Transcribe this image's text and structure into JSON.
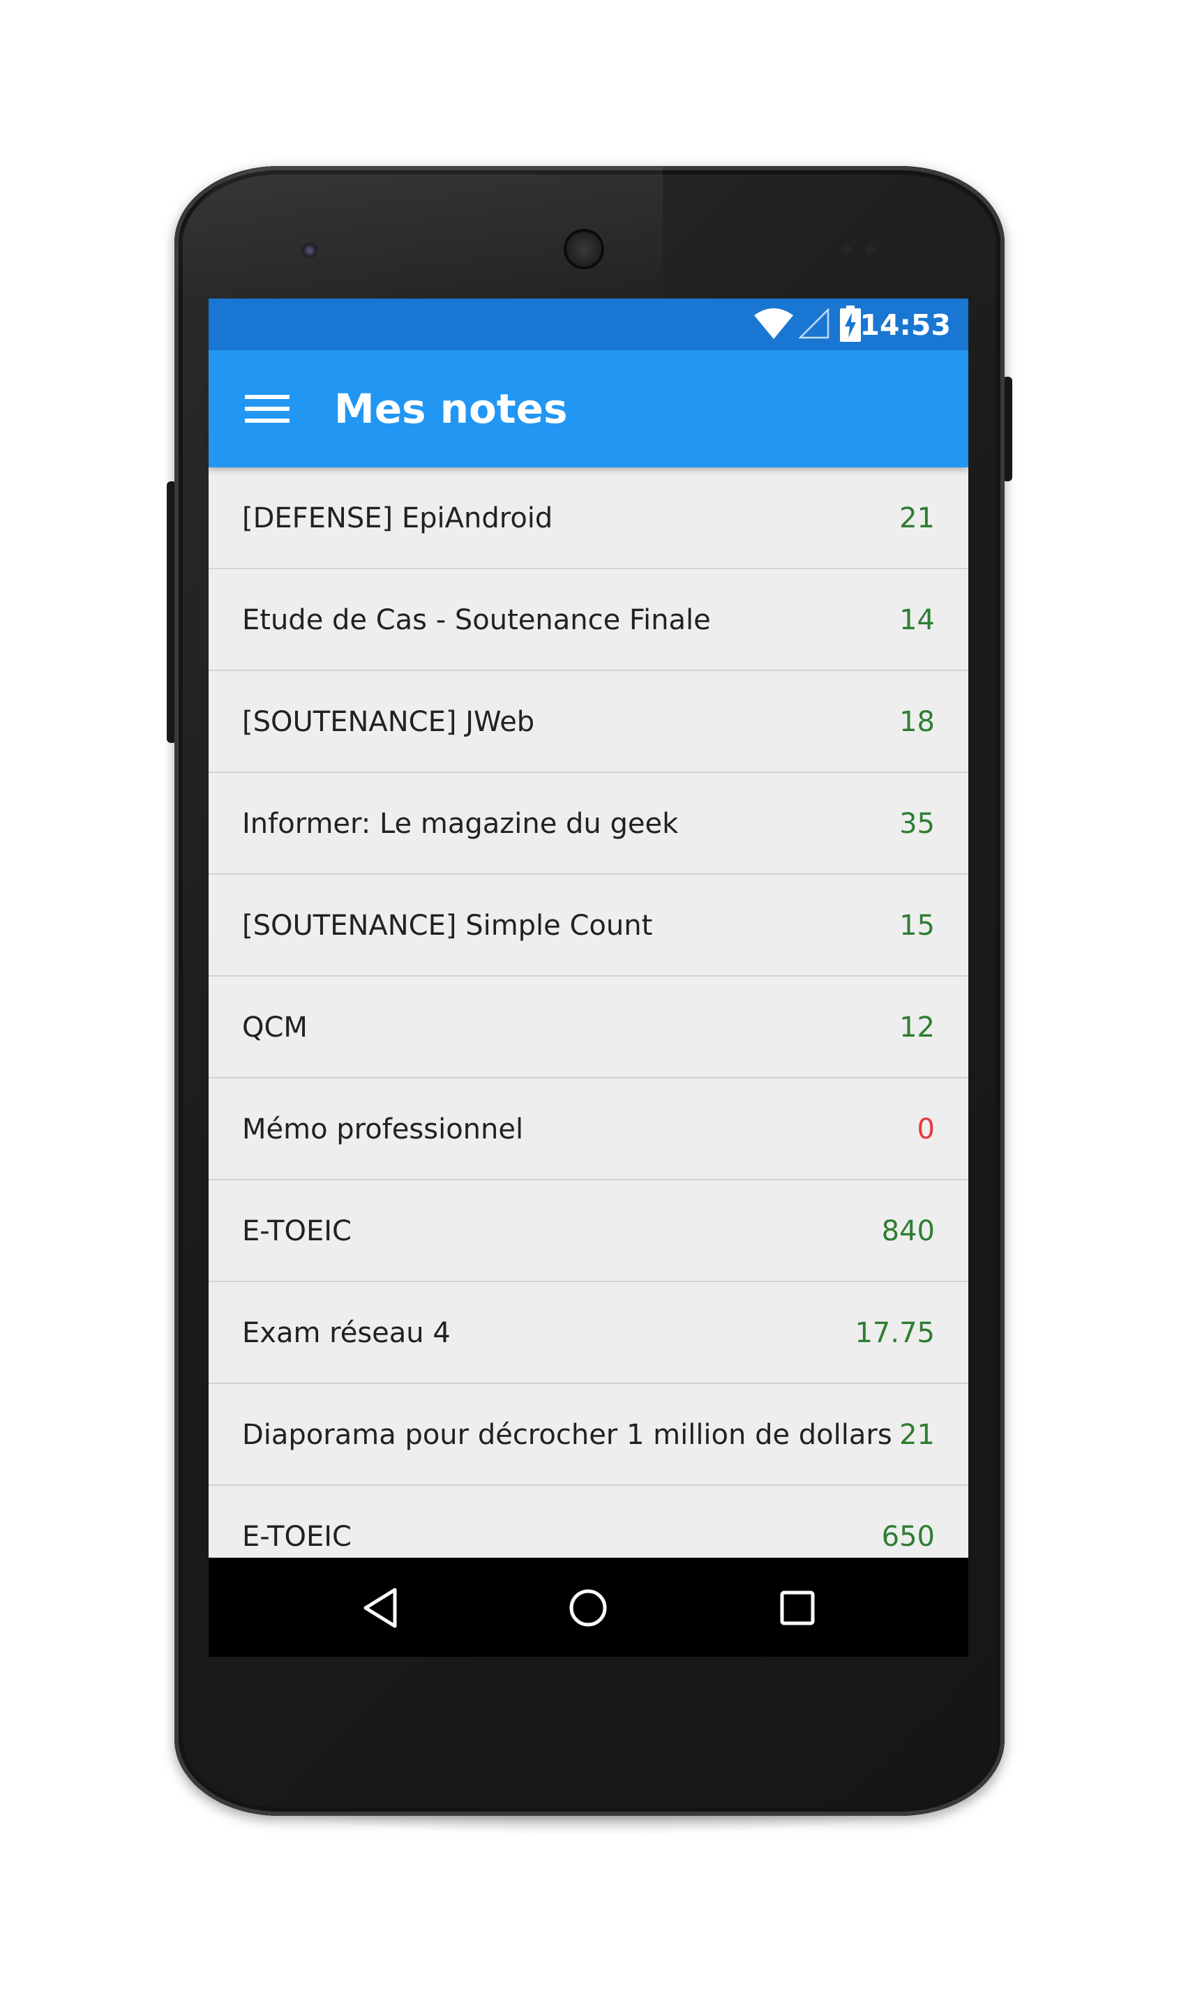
{
  "status_bar": {
    "time": "14:53",
    "icons": [
      "wifi-icon",
      "cellular-signal-icon",
      "battery-charging-icon"
    ]
  },
  "app_bar": {
    "menu_icon": "hamburger-menu-icon",
    "title": "Mes notes"
  },
  "notes": [
    {
      "name": "[DEFENSE] EpiAndroid",
      "grade": "21"
    },
    {
      "name": "Etude de Cas - Soutenance Finale",
      "grade": "14"
    },
    {
      "name": "[SOUTENANCE] JWeb",
      "grade": "18"
    },
    {
      "name": "Informer: Le magazine du geek",
      "grade": "35"
    },
    {
      "name": "[SOUTENANCE] Simple Count",
      "grade": "15"
    },
    {
      "name": "QCM",
      "grade": "12"
    },
    {
      "name": "Mémo professionnel",
      "grade": "0"
    },
    {
      "name": "E-TOEIC",
      "grade": "840"
    },
    {
      "name": "Exam réseau 4",
      "grade": "17.75"
    },
    {
      "name": "Diaporama pour décrocher 1 million de dollars",
      "grade": "21"
    },
    {
      "name": "E-TOEIC",
      "grade": "650"
    }
  ],
  "nav_bar": {
    "icons": [
      "back-icon",
      "home-icon",
      "recents-icon"
    ]
  },
  "colors": {
    "status_bar": "#1976d2",
    "app_bar": "#2196f3",
    "list_background": "#eeeeee",
    "grade_positive": "#2e7d32",
    "grade_zero": "#e53935"
  }
}
